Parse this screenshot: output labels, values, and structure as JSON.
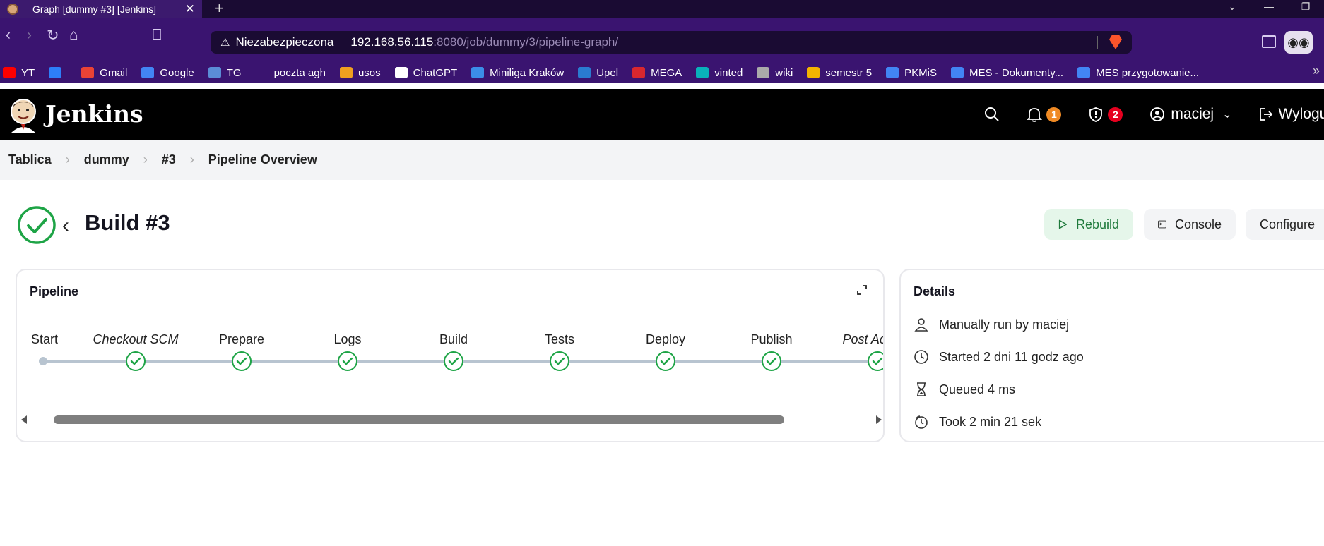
{
  "browser": {
    "tab_title": "Graph [dummy #3] [Jenkins]",
    "url_security": "Niezabezpieczona",
    "url_host": "192.168.56.115",
    "url_path": ":8080/job/dummy/3/pipeline-graph/",
    "bookmarks": [
      {
        "label": "YT",
        "color": "#ff0000"
      },
      {
        "label": "",
        "color": "#2d7ff9"
      },
      {
        "label": "Gmail",
        "color": "#ea4335"
      },
      {
        "label": "Google",
        "color": "#4285f4"
      },
      {
        "label": "TG",
        "color": "#5b8dd6"
      },
      {
        "label": "poczta agh",
        "color": "#3a1470"
      },
      {
        "label": "usos",
        "color": "#f0a020"
      },
      {
        "label": "ChatGPT",
        "color": "#ffffff"
      },
      {
        "label": "Miniliga Kraków",
        "color": "#3b8ee8"
      },
      {
        "label": "Upel",
        "color": "#2a7bd0"
      },
      {
        "label": "MEGA",
        "color": "#d9272e"
      },
      {
        "label": "vinted",
        "color": "#09b1ba"
      },
      {
        "label": "wiki",
        "color": "#aaaaaa"
      },
      {
        "label": "semestr 5",
        "color": "#f4b400"
      },
      {
        "label": "PKMiS",
        "color": "#4285f4"
      },
      {
        "label": "MES - Dokumenty...",
        "color": "#4285f4"
      },
      {
        "label": "MES przygotowanie...",
        "color": "#4285f4"
      }
    ]
  },
  "jenkins": {
    "title": "Jenkins",
    "notifications_count": "1",
    "security_count": "2",
    "user": "maciej",
    "logout": "Wyloguj"
  },
  "breadcrumb": [
    "Tablica",
    "dummy",
    "#3",
    "Pipeline Overview"
  ],
  "build": {
    "title": "Build #3",
    "status": "success",
    "actions": {
      "rebuild": "Rebuild",
      "console": "Console",
      "configure": "Configure"
    }
  },
  "pipeline": {
    "title": "Pipeline",
    "start_label": "Start",
    "stages": [
      {
        "name": "Checkout SCM",
        "italic": true,
        "status": "success"
      },
      {
        "name": "Prepare",
        "italic": false,
        "status": "success"
      },
      {
        "name": "Logs",
        "italic": false,
        "status": "success"
      },
      {
        "name": "Build",
        "italic": false,
        "status": "success"
      },
      {
        "name": "Tests",
        "italic": false,
        "status": "success"
      },
      {
        "name": "Deploy",
        "italic": false,
        "status": "success"
      },
      {
        "name": "Publish",
        "italic": false,
        "status": "success"
      },
      {
        "name": "Post Actions",
        "italic": true,
        "status": "success"
      }
    ]
  },
  "details": {
    "title": "Details",
    "rows": [
      {
        "icon": "user-icon",
        "text": "Manually run by maciej"
      },
      {
        "icon": "clock-icon",
        "text": "Started 2 dni 11 godz ago"
      },
      {
        "icon": "hourglass-icon",
        "text": "Queued 4 ms"
      },
      {
        "icon": "timer-icon",
        "text": "Took 2 min 21 sek"
      }
    ]
  }
}
